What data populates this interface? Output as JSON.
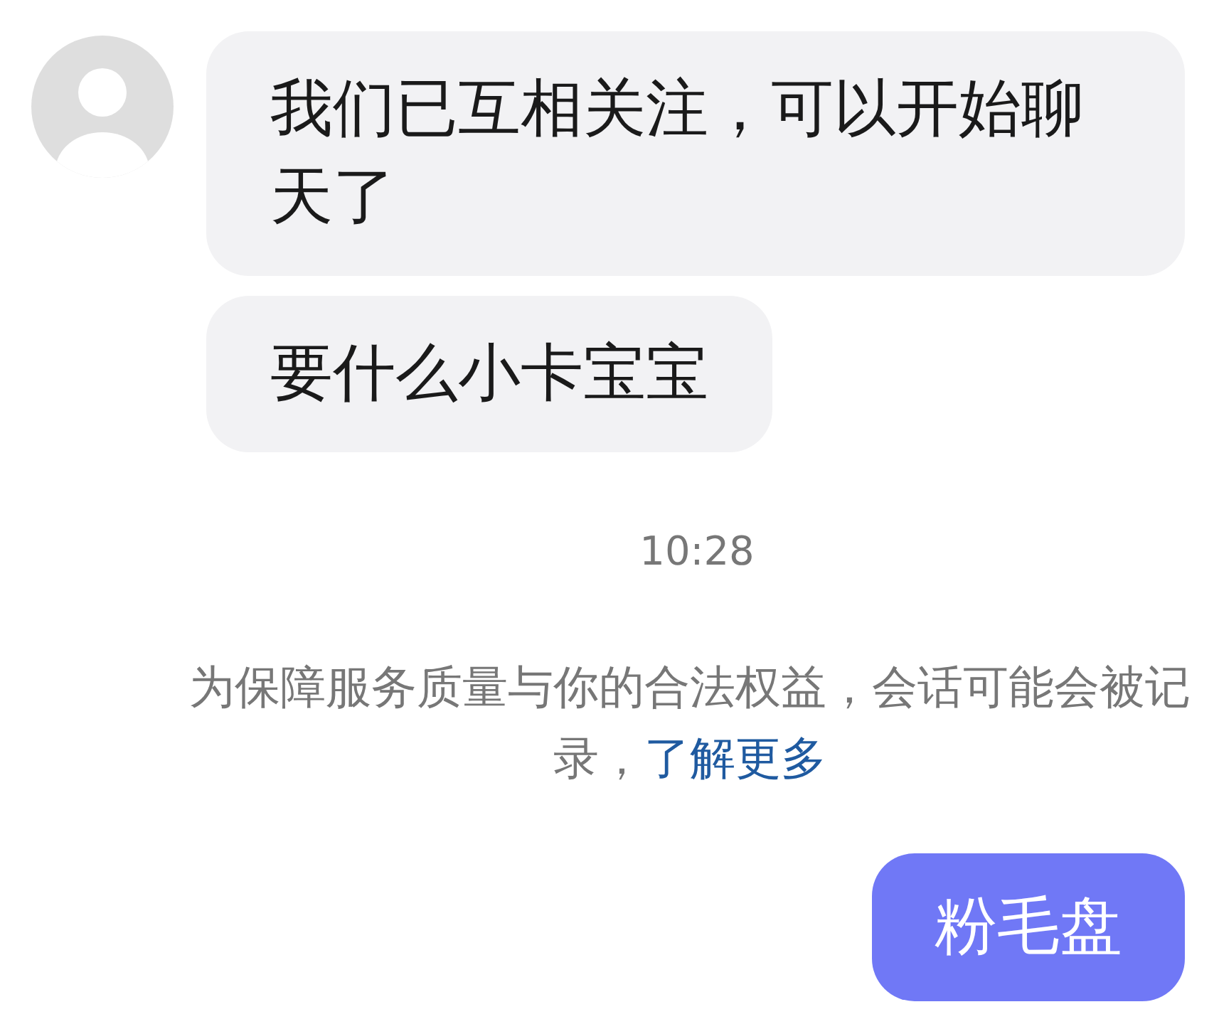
{
  "messages": [
    {
      "kind": "incoming",
      "avatar": true,
      "text": "我们已互相关注，可以开始聊天了"
    },
    {
      "kind": "incoming",
      "avatar": false,
      "text": "要什么小卡宝宝"
    },
    {
      "kind": "time",
      "text": "10:28"
    },
    {
      "kind": "notice",
      "text": "为保障服务质量与你的合法权益，会话可能会被记录，",
      "link": "了解更多"
    },
    {
      "kind": "outgoing",
      "text": "粉毛盘"
    }
  ]
}
